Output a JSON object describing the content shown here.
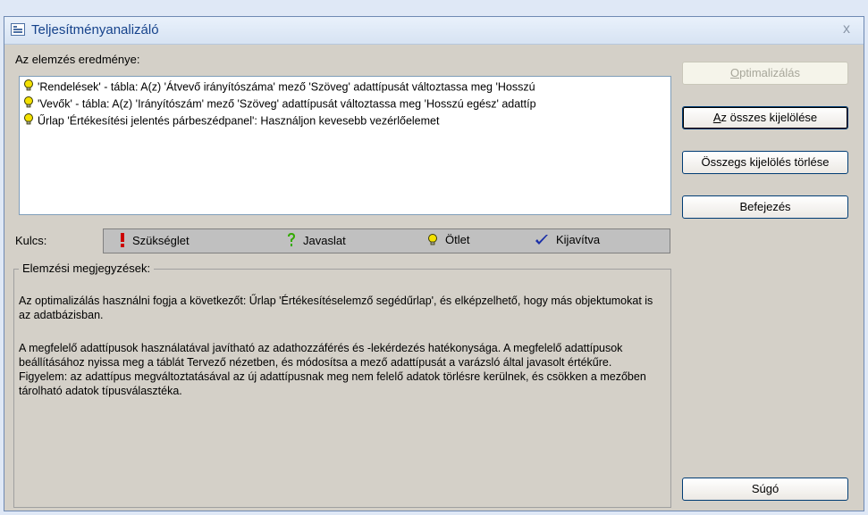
{
  "window": {
    "title": "Teljesítményanalizáló",
    "close": "x"
  },
  "results": {
    "label": "Az elemzés eredménye:",
    "items": [
      {
        "icon": "idea-bulb-icon",
        "text": "'Rendelések' - tábla: A(z) 'Átvevő irányítószáma' mező 'Szöveg' adattípusát változtassa meg 'Hosszú"
      },
      {
        "icon": "idea-bulb-icon",
        "text": "'Vevők' - tábla: A(z) 'Irányítószám' mező 'Szöveg' adattípusát változtassa meg 'Hosszú egész' adattíp"
      },
      {
        "icon": "idea-bulb-icon",
        "text": "Űrlap 'Értékesítési jelentés párbeszédpanel': Használjon kevesebb vezérlőelemet"
      }
    ]
  },
  "key": {
    "label": "Kulcs:",
    "items": [
      {
        "icon": "exclamation-icon",
        "label": "Szükséglet",
        "color": "#cc0000"
      },
      {
        "icon": "question-icon",
        "label": "Javaslat",
        "color": "#33aa00"
      },
      {
        "icon": "idea-bulb-icon",
        "label": "Ötlet",
        "color": "#e8c800"
      },
      {
        "icon": "checkmark-icon",
        "label": "Kijavítva",
        "color": "#1a2fa8"
      }
    ]
  },
  "notes": {
    "legend": "Elemzési megjegyzések:",
    "para1": "Az optimalizálás használni fogja a következőt: Űrlap 'Értékesítéselemző segédűrlap', és elképzelhető, hogy más objektumokat is az adatbázisban.",
    "para2": "A megfelelő adattípusok használatával javítható az adathozzáférés és -lekérdezés hatékonysága. A megfelelő adattípusok beállításához nyissa meg a táblát Tervező nézetben, és módosítsa a mező adattípusát a varázsló által javasolt értékűre. Figyelem: az adattípus megváltoztatásával az új adattípusnak meg nem felelő adatok törlésre kerülnek, és csökken a mezőben tárolható adatok típusválasztéka."
  },
  "buttons": {
    "optimize": {
      "pre": "",
      "acc": "O",
      "post": "ptimalizálás"
    },
    "select_all": {
      "pre": "",
      "acc": "A",
      "post": "z összes kijelölése"
    },
    "deselect_all": {
      "pre": "Össze",
      "acc": "g",
      "post": "s kijelölés törlése"
    },
    "close": {
      "pre": "Befejezés",
      "acc": "",
      "post": ""
    },
    "help": {
      "pre": "Súgó",
      "acc": "",
      "post": ""
    }
  }
}
